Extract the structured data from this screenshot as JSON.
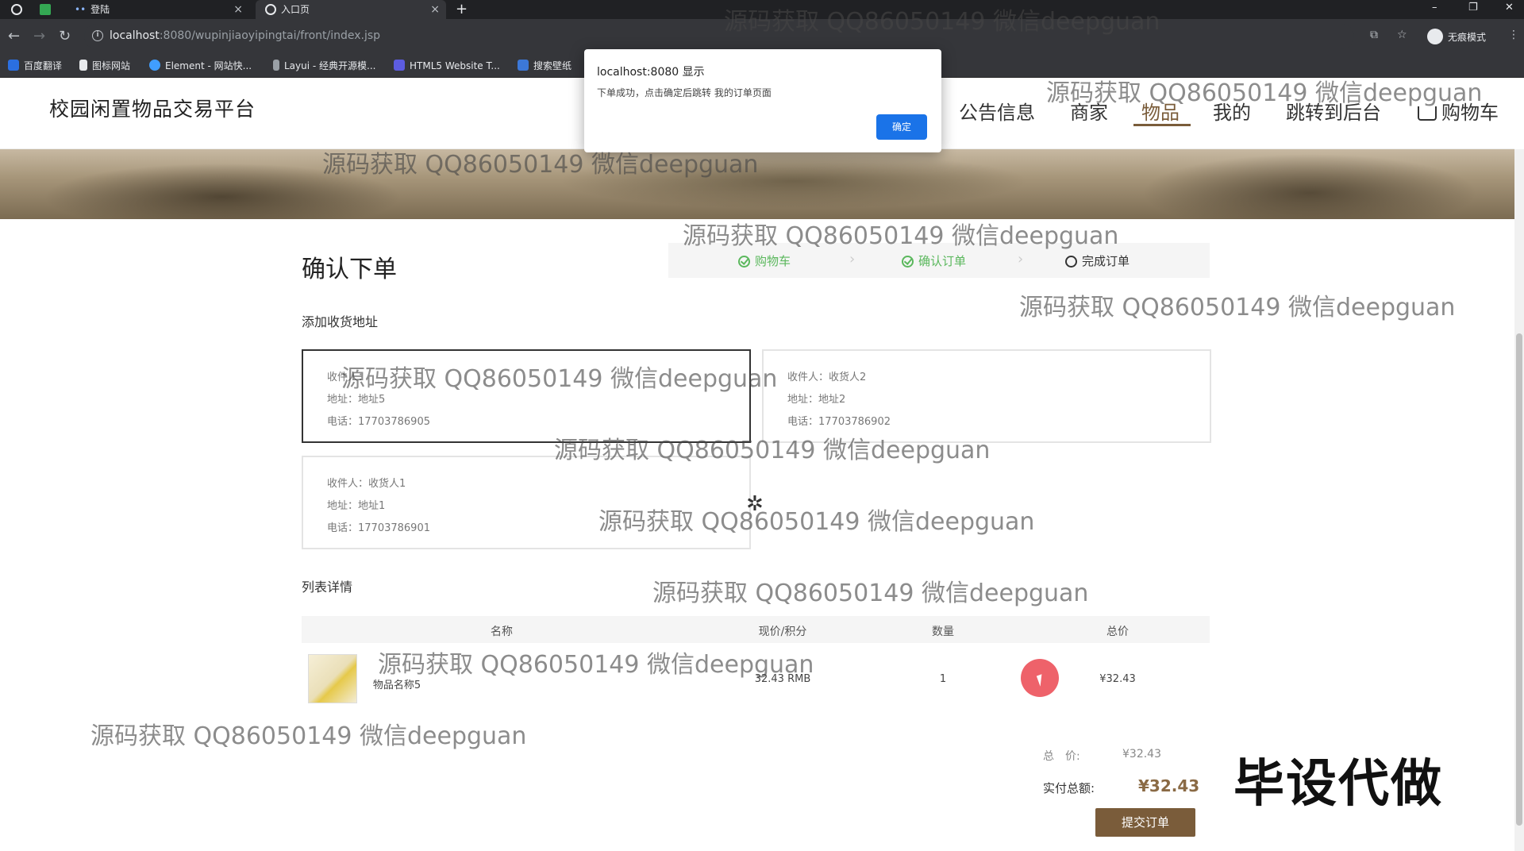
{
  "browser": {
    "tabs": [
      {
        "label": ""
      },
      {
        "label": "登陆"
      },
      {
        "label": "入口页"
      }
    ],
    "new_tab": "+",
    "url_host": "localhost",
    "url_path": ":8080/wupinjiaoyipingtai/front/index.jsp",
    "incognito_label": "无痕模式",
    "bookmarks": [
      {
        "label": "百度翻译",
        "color": "#2b6fe0"
      },
      {
        "label": "图标网站",
        "color": "#e8eaed"
      },
      {
        "label": "Element - 网站快...",
        "color": "#409eff"
      },
      {
        "label": "Layui - 经典开源模...",
        "color": "#9aa0a6"
      },
      {
        "label": "HTML5 Website T...",
        "color": "#5c5ce0"
      },
      {
        "label": "搜索壁纸",
        "color": "#3c78d8"
      }
    ]
  },
  "dialog": {
    "title": "localhost:8080 显示",
    "message": "下单成功，点击确定后跳转 我的订单页面",
    "ok_label": "确定"
  },
  "header": {
    "logo": "校园闲置物品交易平台",
    "nav": [
      {
        "label": "公告信息"
      },
      {
        "label": "商家"
      },
      {
        "label": "物品"
      },
      {
        "label": "我的"
      },
      {
        "label": "跳转到后台"
      },
      {
        "label": "购物车"
      }
    ],
    "active_nav": "物品"
  },
  "order": {
    "title": "确认下单",
    "steps": [
      {
        "label": "购物车",
        "status": "done"
      },
      {
        "label": "确认订单",
        "status": "done"
      },
      {
        "label": "完成订单",
        "status": "pending"
      }
    ],
    "address_section_label": "添加收货地址",
    "addresses": [
      {
        "receiver": "收件人：",
        "address": "地址：地址5",
        "phone": "电话：17703786905",
        "selected": true
      },
      {
        "receiver": "收件人：收货人2",
        "address": "地址：地址2",
        "phone": "电话：17703786902",
        "selected": false
      },
      {
        "receiver": "收件人：收货人1",
        "address": "地址：地址1",
        "phone": "电话：17703786901",
        "selected": false
      }
    ],
    "list_section_label": "列表详情",
    "table": {
      "headers": [
        "名称",
        "现价/积分",
        "数量",
        "总价"
      ],
      "rows": [
        {
          "name": "物品名称5",
          "price": "32.43 RMB",
          "qty": "1",
          "total": "¥32.43"
        }
      ]
    },
    "summary": {
      "total_label": "总　价:",
      "total_value": "¥32.43",
      "pay_label": "实付总额:",
      "pay_value": "¥32.43"
    },
    "submit_label": "提交订单"
  },
  "watermarks": [
    "源码获取 QQ86050149 微信deepguan",
    "源码获取 QQ86050149 微信deepguan",
    "源码获取 QQ86050149 微信deepguan",
    "源码获取 QQ86050149 微信deepguan",
    "源码获取 QQ86050149 微信deepguan",
    "源码获取 QQ86050149 微信deepguan",
    "源码获取 QQ86050149 微信deepguan",
    "源码获取 QQ86050149 微信deepguan",
    "源码获取 QQ86050149 微信deepguan",
    "源码获取 QQ86050149 微信deepguan",
    "源码获取 QQ86050149 微信deepguan"
  ],
  "stamp": "毕设代做",
  "colors": {
    "accent": "#7a5c3a",
    "step_done": "#5bb85d",
    "dialog_button": "#1a73e8"
  }
}
